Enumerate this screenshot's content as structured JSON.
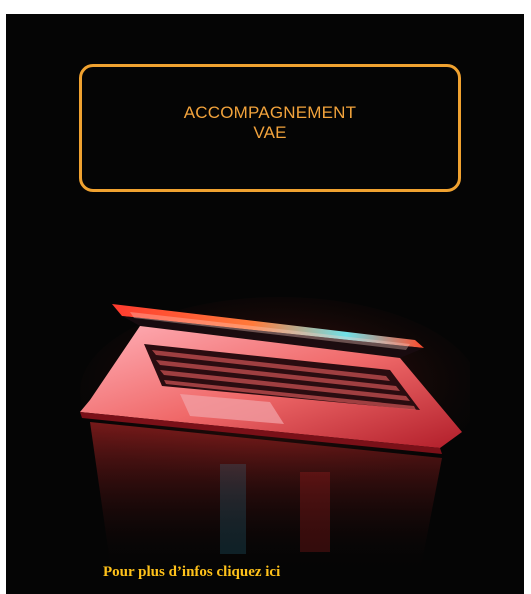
{
  "banner": {
    "title_line1": "ACCOMPAGNEMENT",
    "title_line2": "VAE",
    "accent_color": "#f0a230",
    "background_color": "#050505",
    "image_subject": "laptop-icon"
  },
  "cta": {
    "label": "Pour plus d’infos cliquez ici",
    "color": "#ffc21a"
  }
}
